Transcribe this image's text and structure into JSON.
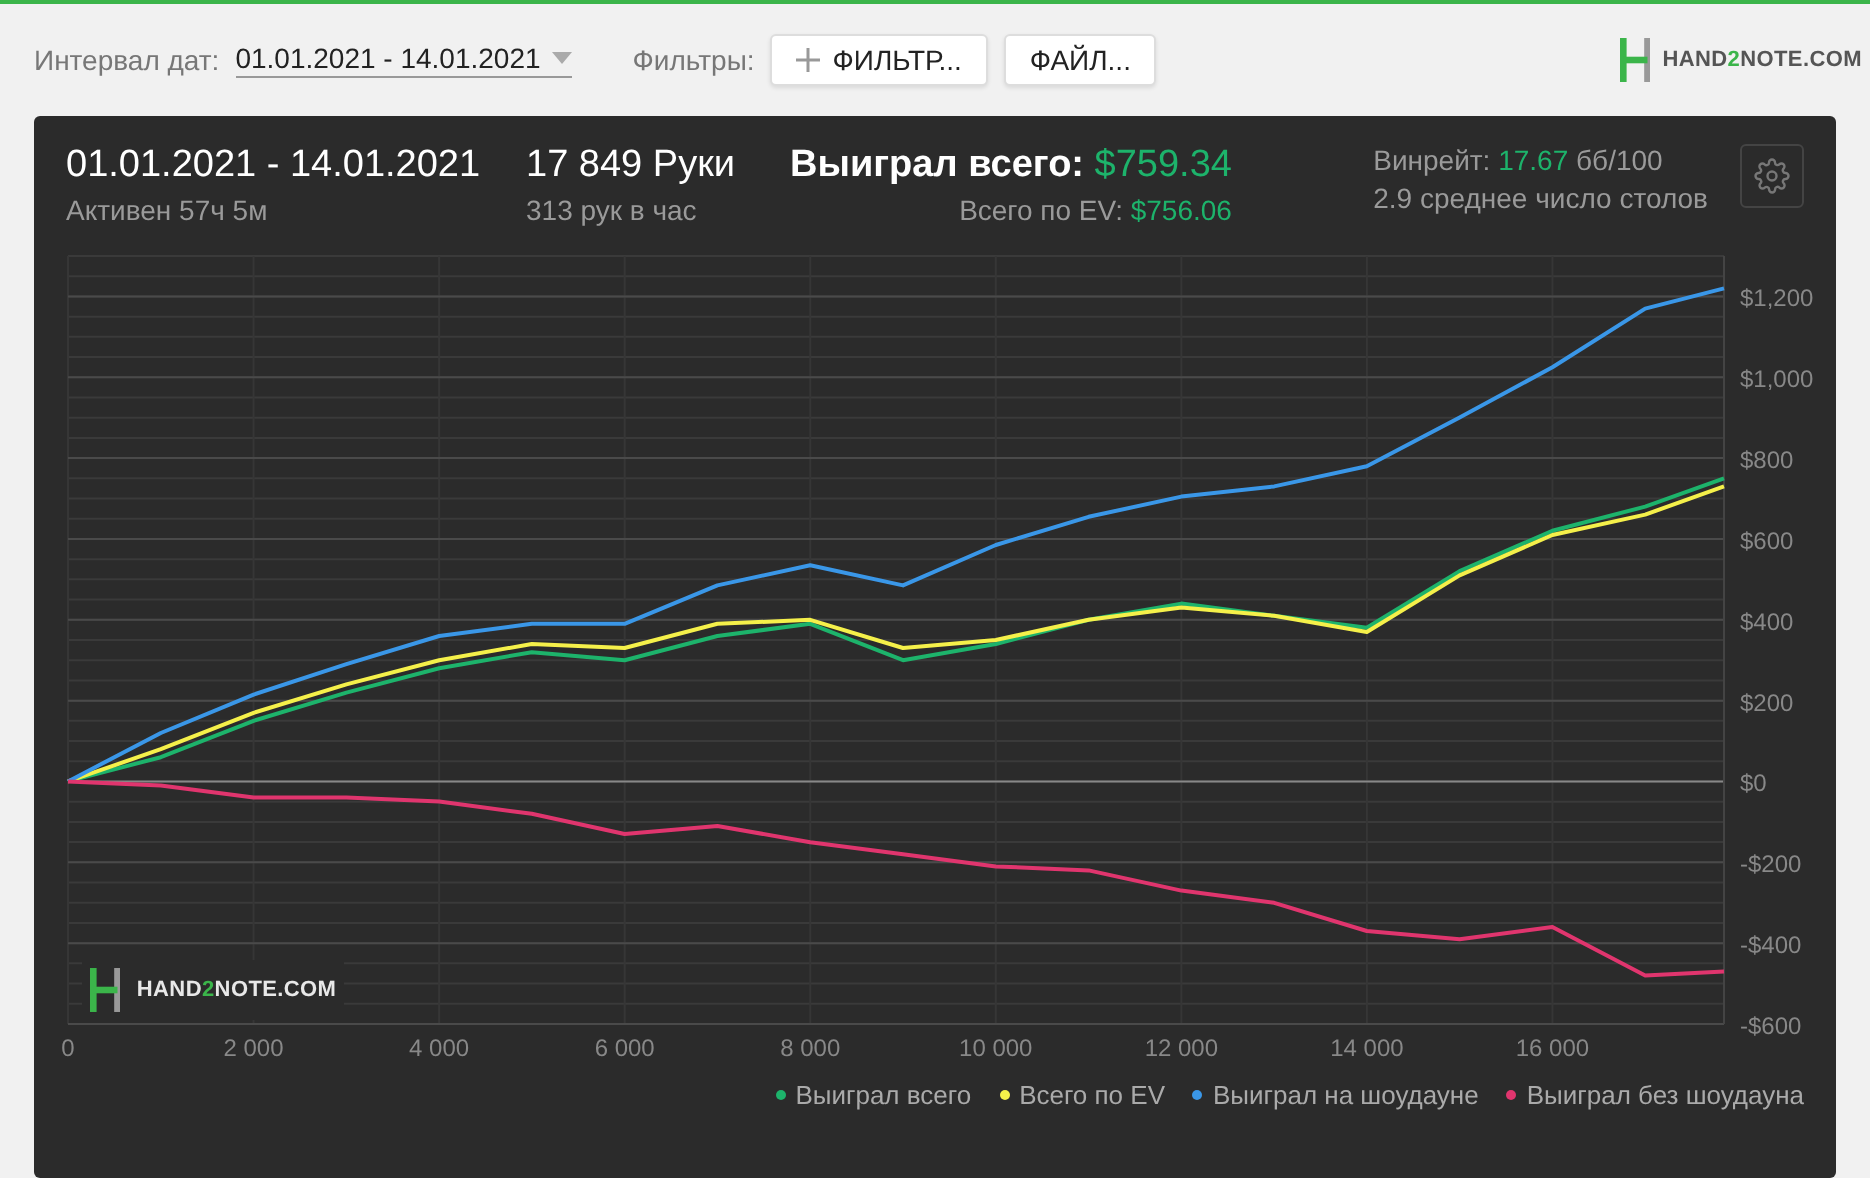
{
  "toolbar": {
    "date_label": "Интервал дат:",
    "date_value": "01.01.2021 - 14.01.2021",
    "filters_label": "Фильтры:",
    "filter_button": "ФИЛЬТР...",
    "file_button": "ФАЙЛ...",
    "logo": {
      "before": "HAND",
      "accent": "2",
      "after": "NOTE.COM"
    }
  },
  "summary": {
    "period": "01.01.2021 - 14.01.2021",
    "active": "Активен 57ч 5м",
    "hands": "17 849 Руки",
    "hands_per_hour": "313 рук в час",
    "won_label": "Выиграл всего:",
    "won_value": "$759.34",
    "ev_label": "Всего по EV:",
    "ev_value": "$756.06",
    "winrate_label": "Винрейт:",
    "winrate_value": "17.67",
    "winrate_unit": "бб/100",
    "tables": "2.9 среднее число столов"
  },
  "chart_data": {
    "type": "line",
    "x": [
      0,
      1000,
      2000,
      3000,
      4000,
      5000,
      6000,
      7000,
      8000,
      9000,
      10000,
      11000,
      12000,
      13000,
      14000,
      15000,
      16000,
      17000,
      17849
    ],
    "grid": true,
    "legend": true,
    "xlim": [
      0,
      17849
    ],
    "ylim": [
      -600,
      1300
    ],
    "xticks": [
      {
        "value": 0,
        "label": "0"
      },
      {
        "value": 2000,
        "label": "2 000"
      },
      {
        "value": 4000,
        "label": "4 000"
      },
      {
        "value": 6000,
        "label": "6 000"
      },
      {
        "value": 8000,
        "label": "8 000"
      },
      {
        "value": 10000,
        "label": "10 000"
      },
      {
        "value": 12000,
        "label": "12 000"
      },
      {
        "value": 14000,
        "label": "14 000"
      },
      {
        "value": 16000,
        "label": "16 000"
      }
    ],
    "yticks": [
      {
        "value": 1200,
        "label": "$1,200"
      },
      {
        "value": 1000,
        "label": "$1,000"
      },
      {
        "value": 800,
        "label": "$800"
      },
      {
        "value": 600,
        "label": "$600"
      },
      {
        "value": 400,
        "label": "$400"
      },
      {
        "value": 200,
        "label": "$200"
      },
      {
        "value": 0,
        "label": "$0"
      },
      {
        "value": -200,
        "label": "-$200"
      },
      {
        "value": -400,
        "label": "-$400"
      },
      {
        "value": -600,
        "label": "-$600"
      }
    ],
    "series": [
      {
        "name": "Выиграл всего",
        "color": "#1db36b",
        "values": [
          0,
          60,
          150,
          220,
          280,
          320,
          300,
          360,
          390,
          300,
          340,
          400,
          440,
          410,
          380,
          520,
          620,
          680,
          750
        ]
      },
      {
        "name": "Всего по EV",
        "color": "#f5f04a",
        "values": [
          0,
          80,
          170,
          240,
          300,
          340,
          330,
          390,
          400,
          330,
          350,
          400,
          430,
          410,
          370,
          510,
          610,
          660,
          730
        ]
      },
      {
        "name": "Выиграл на шоудауне",
        "color": "#3a97e8",
        "values": [
          0,
          120,
          215,
          290,
          360,
          390,
          390,
          485,
          535,
          485,
          585,
          655,
          705,
          730,
          780,
          900,
          1025,
          1170,
          1220
        ]
      },
      {
        "name": "Выиграл без шоудауна",
        "color": "#e0356e",
        "values": [
          0,
          -10,
          -40,
          -40,
          -50,
          -80,
          -130,
          -110,
          -150,
          -180,
          -210,
          -220,
          -270,
          -300,
          -370,
          -390,
          -360,
          -480,
          -470
        ]
      }
    ]
  },
  "watermark": {
    "before": "HAND",
    "accent": "2",
    "after": "NOTE.COM"
  }
}
